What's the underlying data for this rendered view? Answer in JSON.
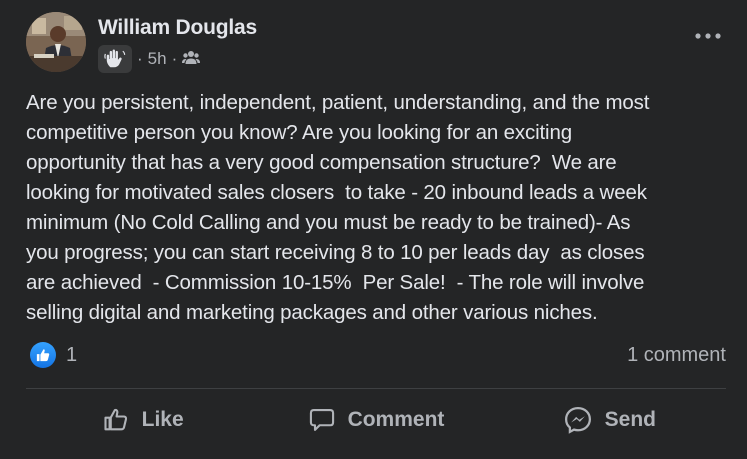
{
  "post": {
    "author": "William Douglas",
    "time": "5h",
    "audience_icon": "group-icon",
    "badge_icon": "raised-hand-icon",
    "body": "Are you persistent, independent, patient, understanding, and the most\ncompetitive person you know? Are you looking for an exciting\nopportunity that has a very good compensation structure?  We are\nlooking for motivated sales closers  to take - 20 inbound leads a week\nminimum (No Cold Calling and you must be ready to be trained)- As\nyou progress; you can start receiving 8 to 10 per leads day  as closes\nare achieved  - Commission 10-15%  Per Sale!  - The role will involve\nselling digital and marketing packages and other various niches."
  },
  "stats": {
    "likes": "1",
    "comments": "1 comment"
  },
  "actions": {
    "like": "Like",
    "comment": "Comment",
    "send": "Send"
  },
  "colors": {
    "background": "#242526",
    "text": "#e4e6eb",
    "secondary_text": "#b0b3b8",
    "like_blue": "#1877f2"
  }
}
